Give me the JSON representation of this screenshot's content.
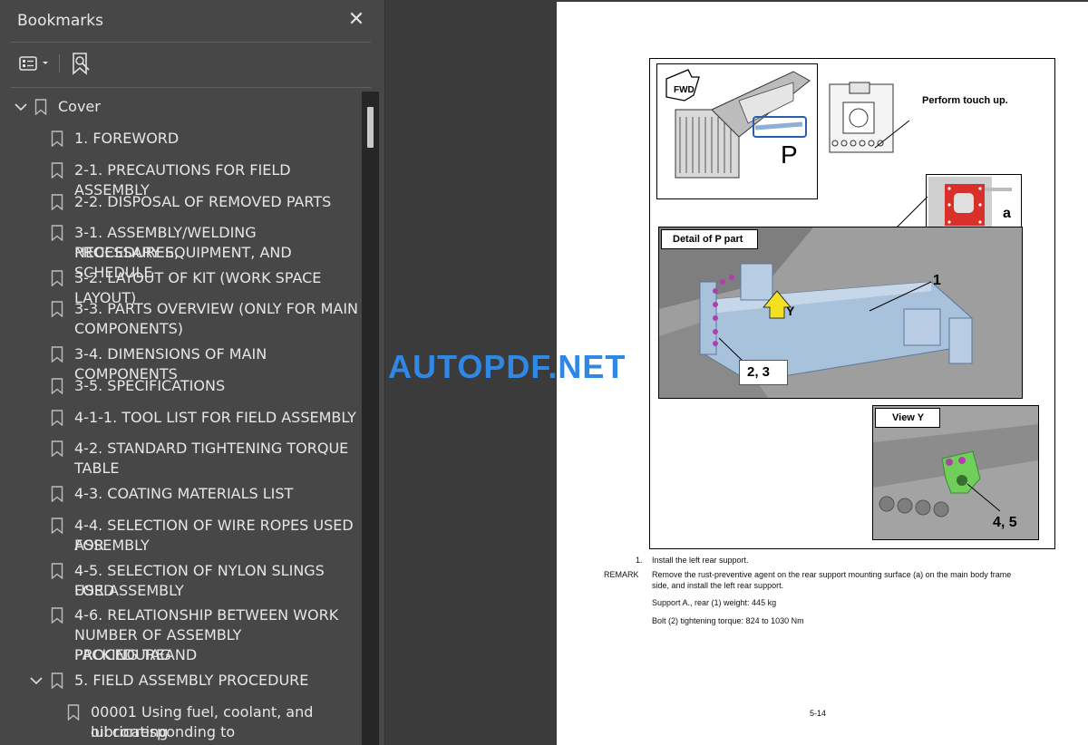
{
  "sidebar": {
    "title": "Bookmarks",
    "close_glyph": "✕",
    "items": [
      {
        "label": "Cover",
        "level": 0,
        "expanded": true
      },
      {
        "label": "1. FOREWORD",
        "level": 1
      },
      {
        "label": "2-1. PRECAUTIONS FOR FIELD ASSEMBLY",
        "level": 1
      },
      {
        "label": "2-2. DISPOSAL OF REMOVED PARTS",
        "level": 1
      },
      {
        "label": "3-1. ASSEMBLY/WELDING PROCEDURES,",
        "label2": "NECESSARY EQUIPMENT, AND SCHEDULE",
        "level": 1
      },
      {
        "label": "3-2. LAYOUT OF KIT (WORK SPACE LAYOUT)",
        "level": 1
      },
      {
        "label": "3-3. PARTS OVERVIEW (ONLY FOR MAIN",
        "label2": "COMPONENTS)",
        "level": 1
      },
      {
        "label": "3-4. DIMENSIONS OF MAIN COMPONENTS",
        "level": 1
      },
      {
        "label": "3-5. SPECIFICATIONS",
        "level": 1
      },
      {
        "label": "4-1-1. TOOL LIST FOR FIELD ASSEMBLY",
        "level": 1
      },
      {
        "label": "4-2. STANDARD TIGHTENING TORQUE",
        "label2": "TABLE",
        "level": 1
      },
      {
        "label": "4-3. COATING MATERIALS LIST",
        "level": 1
      },
      {
        "label": "4-4. SELECTION OF WIRE ROPES USED FOR",
        "label2": "ASSEMBLY",
        "level": 1
      },
      {
        "label": "4-5. SELECTION OF NYLON SLINGS USED",
        "label2": "FOR ASSEMBLY",
        "level": 1
      },
      {
        "label": "4-6. RELATIONSHIP BETWEEN WORK",
        "label2": "NUMBER OF ASSEMBLY PROCEDUREAND",
        "label3": "PACKING TAG",
        "level": 1
      },
      {
        "label": "5. FIELD ASSEMBLY PROCEDURE",
        "level": 1,
        "expanded": true
      },
      {
        "label": "00001 Using fuel, coolant, and lubricating",
        "label2": "oil corresponding to ambienttemperature",
        "level": 2
      }
    ]
  },
  "watermark": "AUTOPDF.NET",
  "document": {
    "figure": {
      "fwd_label": "FWD",
      "p_label": "P",
      "touch_up": "Perform touch up.",
      "a_label": "a",
      "detail_title": "Detail of P part",
      "callout_1": "1",
      "callout_y": "Y",
      "callout_23": "2, 3",
      "view_y_title": "View Y",
      "callout_45": "4, 5"
    },
    "step_number": "1.",
    "step_text": "Install the left rear support.",
    "remark_label": "REMARK",
    "remark_line1": "Remove the rust-preventive agent on the rear support mounting surface (a) on the main body frame",
    "remark_line2": "side, and install the left rear support.",
    "weight_line": "Support A., rear (1) weight: 445 kg",
    "torque_line": "Bolt (2) tightening torque: 824 to 1030 Nm",
    "page_number": "5-14"
  },
  "colors": {
    "sidebar_bg": "#474747",
    "viewer_bg": "#3b3b3b",
    "watermark": "#2f87e6",
    "frame_blue": "#a9c2dc",
    "rust_red": "#d9302a",
    "bolt_magenta": "#b03fae",
    "bracket_green": "#6fcf5a",
    "arrow_yellow": "#f2e021"
  }
}
